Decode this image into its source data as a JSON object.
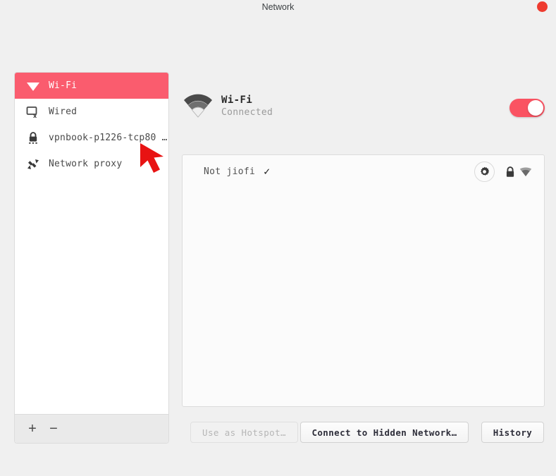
{
  "window": {
    "title": "Network",
    "recording_indicator": "record-dot",
    "background_color": "#f0f0f0"
  },
  "sidebar": {
    "items": [
      {
        "label": "Wi-Fi",
        "icon": "wifi-icon",
        "selected": true
      },
      {
        "label": "Wired",
        "icon": "wired-disconnected-icon",
        "selected": false
      },
      {
        "label": "vpnbook-p1226-tcp80 …",
        "icon": "vpn-lock-icon",
        "selected": false
      },
      {
        "label": "Network proxy",
        "icon": "proxy-arrows-icon",
        "selected": false
      }
    ],
    "toolbar": {
      "add_label": "+",
      "remove_label": "−"
    },
    "selected_color": "#fa5c6e"
  },
  "main": {
    "header": {
      "icon": "wifi-signal-icon",
      "title": "Wi-Fi",
      "status": "Connected",
      "toggle": {
        "state": "on",
        "on_color": "#fa5362"
      }
    },
    "networks": [
      {
        "name": "Not jiofi",
        "connected_check": "✓",
        "settings_icon": "gear-icon",
        "secured_icon": "lock-icon",
        "signal_icon": "wifi-signal-icon"
      }
    ],
    "buttons": {
      "hotspot": {
        "label": "Use as Hotspot…",
        "enabled": false
      },
      "hidden_network": {
        "label": "Connect to Hidden Network…",
        "enabled": true
      },
      "history": {
        "label": "History",
        "enabled": true
      }
    }
  },
  "cursor": {
    "type": "arrow-pointer",
    "color": "#e81313"
  }
}
